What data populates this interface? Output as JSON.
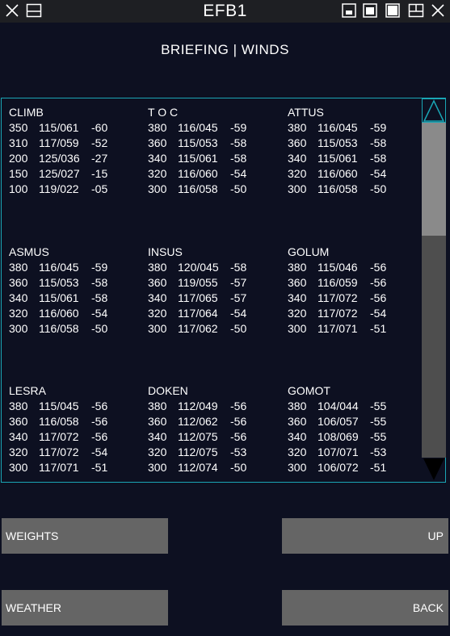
{
  "window": {
    "title": "EFB1",
    "icons": [
      "close-icon",
      "restore-icon",
      "minimize-icon",
      "square-icon",
      "maximize-icon",
      "window-icon",
      "close-icon"
    ]
  },
  "page": {
    "heading": "BRIEFING | WINDS"
  },
  "waypoints": [
    {
      "name": "CLIMB",
      "rows": [
        [
          "350",
          "115/061",
          "-60"
        ],
        [
          "310",
          "117/059",
          "-52"
        ],
        [
          "200",
          "125/036",
          "-27"
        ],
        [
          "150",
          "125/027",
          "-15"
        ],
        [
          "100",
          "119/022",
          "-05"
        ]
      ]
    },
    {
      "name": "T O C",
      "rows": [
        [
          "380",
          "116/045",
          "-59"
        ],
        [
          "360",
          "115/053",
          "-58"
        ],
        [
          "340",
          "115/061",
          "-58"
        ],
        [
          "320",
          "116/060",
          "-54"
        ],
        [
          "300",
          "116/058",
          "-50"
        ]
      ]
    },
    {
      "name": "ATTUS",
      "rows": [
        [
          "380",
          "116/045",
          "-59"
        ],
        [
          "360",
          "115/053",
          "-58"
        ],
        [
          "340",
          "115/061",
          "-58"
        ],
        [
          "320",
          "116/060",
          "-54"
        ],
        [
          "300",
          "116/058",
          "-50"
        ]
      ]
    },
    {
      "name": "ASMUS",
      "rows": [
        [
          "380",
          "116/045",
          "-59"
        ],
        [
          "360",
          "115/053",
          "-58"
        ],
        [
          "340",
          "115/061",
          "-58"
        ],
        [
          "320",
          "116/060",
          "-54"
        ],
        [
          "300",
          "116/058",
          "-50"
        ]
      ]
    },
    {
      "name": "INSUS",
      "rows": [
        [
          "380",
          "120/045",
          "-58"
        ],
        [
          "360",
          "119/055",
          "-57"
        ],
        [
          "340",
          "117/065",
          "-57"
        ],
        [
          "320",
          "117/064",
          "-54"
        ],
        [
          "300",
          "117/062",
          "-50"
        ]
      ]
    },
    {
      "name": "GOLUM",
      "rows": [
        [
          "380",
          "115/046",
          "-56"
        ],
        [
          "360",
          "116/059",
          "-56"
        ],
        [
          "340",
          "117/072",
          "-56"
        ],
        [
          "320",
          "117/072",
          "-54"
        ],
        [
          "300",
          "117/071",
          "-51"
        ]
      ]
    },
    {
      "name": "LESRA",
      "rows": [
        [
          "380",
          "115/045",
          "-56"
        ],
        [
          "360",
          "116/058",
          "-56"
        ],
        [
          "340",
          "117/072",
          "-56"
        ],
        [
          "320",
          "117/072",
          "-54"
        ],
        [
          "300",
          "117/071",
          "-51"
        ]
      ]
    },
    {
      "name": "DOKEN",
      "rows": [
        [
          "380",
          "112/049",
          "-56"
        ],
        [
          "360",
          "112/062",
          "-56"
        ],
        [
          "340",
          "112/075",
          "-56"
        ],
        [
          "320",
          "112/075",
          "-53"
        ],
        [
          "300",
          "112/074",
          "-50"
        ]
      ]
    },
    {
      "name": "GOMOT",
      "rows": [
        [
          "380",
          "104/044",
          "-55"
        ],
        [
          "360",
          "106/057",
          "-55"
        ],
        [
          "340",
          "108/069",
          "-55"
        ],
        [
          "320",
          "107/071",
          "-53"
        ],
        [
          "300",
          "106/072",
          "-51"
        ]
      ]
    }
  ],
  "buttons": {
    "weights": "WEIGHTS",
    "up": "UP",
    "weather": "WEATHER",
    "back": "BACK"
  },
  "colors": {
    "background": "#0d1021",
    "panel_border": "#1aa6b5",
    "button": "#656565",
    "scroll_thumb": "#8a8a8a",
    "scroll_track": "#4e4e4e"
  }
}
